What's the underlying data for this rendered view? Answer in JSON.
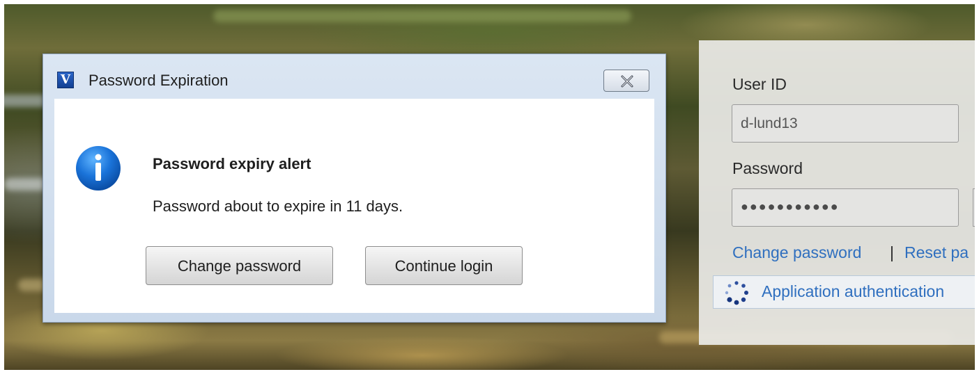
{
  "dialog": {
    "app_logo_letter": "V",
    "title": "Password Expiration",
    "heading": "Password expiry alert",
    "message": "Password about to expire in 11 days.",
    "change_button": "Change password",
    "continue_button": "Continue login",
    "icon": "info-icon",
    "close_icon": "close-icon"
  },
  "login": {
    "user_id_label": "User ID",
    "user_id_value": "d-lund13",
    "password_label": "Password",
    "password_mask": "●●●●●●●●●●●",
    "change_password_link": "Change password",
    "separator": "|",
    "reset_link": "Reset pa",
    "auth_status": "Application authentication",
    "spinner_icon": "loading-spinner-icon"
  },
  "colors": {
    "link": "#2f6fbf",
    "dialog_frame": "#c9d8ea",
    "info_icon": "#1a73d9"
  }
}
